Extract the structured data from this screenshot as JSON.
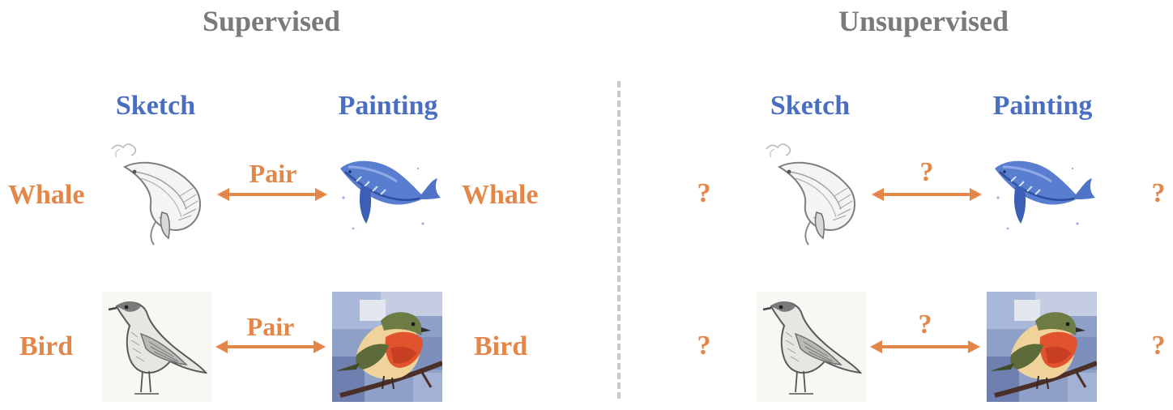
{
  "supervised": {
    "title": "Supervised",
    "sketch_label": "Sketch",
    "painting_label": "Painting",
    "row1": {
      "left_label": "Whale",
      "pair_label": "Pair",
      "right_label": "Whale"
    },
    "row2": {
      "left_label": "Bird",
      "pair_label": "Pair",
      "right_label": "Bird"
    }
  },
  "unsupervised": {
    "title": "Unsupervised",
    "sketch_label": "Sketch",
    "painting_label": "Painting",
    "row1": {
      "left_label": "?",
      "pair_label": "?",
      "right_label": "?"
    },
    "row2": {
      "left_label": "?",
      "pair_label": "?",
      "right_label": "?"
    }
  },
  "colors": {
    "title": "#7a7a7a",
    "domain": "#4a6fc0",
    "accent": "#e2864a",
    "divider": "#c8c8c8"
  },
  "icons": [
    "whale-sketch-icon",
    "whale-painting-icon",
    "bird-sketch-icon",
    "bird-painting-icon",
    "double-arrow-icon"
  ]
}
